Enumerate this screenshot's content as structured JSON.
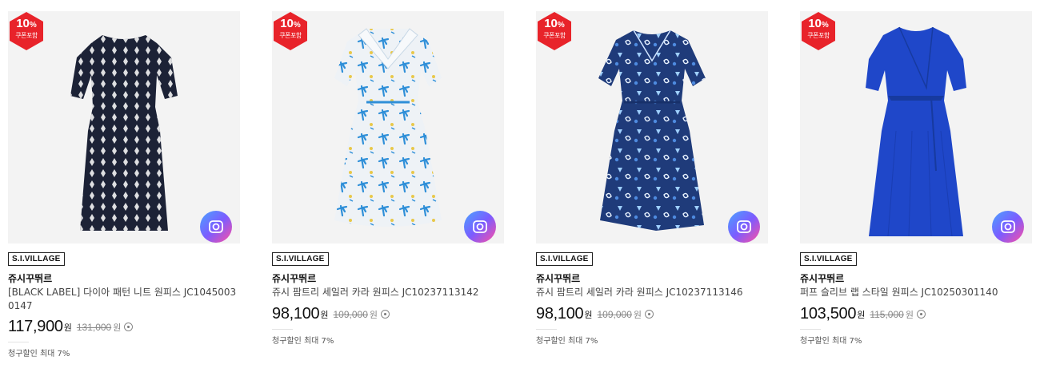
{
  "products": [
    {
      "badge_percent": "10",
      "badge_unit": "%",
      "badge_sub": "쿠폰포함",
      "mall_tag": "S.I.VILLAGE",
      "brand": "쥬시꾸뛰르",
      "name": "[BLACK LABEL] 다이아 패턴 니트 원피스 JC1045003 0147",
      "price": "117,900",
      "price_unit": "원",
      "original_price": "131,000",
      "original_unit": "원",
      "discount_note": "청구할인 최대 7%",
      "dress_color": "#1c2236",
      "pattern_color": "#f4f4f4"
    },
    {
      "badge_percent": "10",
      "badge_unit": "%",
      "badge_sub": "쿠폰포함",
      "mall_tag": "S.I.VILLAGE",
      "brand": "쥬시꾸뛰르",
      "name": "쥬시 팜트리 세일러 카라 원피스 JC10237113142",
      "price": "98,100",
      "price_unit": "원",
      "original_price": "109,000",
      "original_unit": "원",
      "discount_note": "청구할인 최대 7%",
      "dress_color": "#eef2f6",
      "pattern_color": "#2f8fd8"
    },
    {
      "badge_percent": "10",
      "badge_unit": "%",
      "badge_sub": "쿠폰포함",
      "mall_tag": "S.I.VILLAGE",
      "brand": "쥬시꾸뛰르",
      "name": "쥬시 팜트리 세일러 카라 원피스 JC10237113146",
      "price": "98,100",
      "price_unit": "원",
      "original_price": "109,000",
      "original_unit": "원",
      "discount_note": "청구할인 최대 7%",
      "dress_color": "#1f3b7a",
      "pattern_color": "#9fd0ff"
    },
    {
      "badge_percent": "10",
      "badge_unit": "%",
      "badge_sub": "쿠폰포함",
      "mall_tag": "S.I.VILLAGE",
      "brand": "쥬시꾸뛰르",
      "name": "퍼프 슬리브 랩 스타일 원피스 JC10250301140",
      "price": "103,500",
      "price_unit": "원",
      "original_price": "115,000",
      "original_unit": "원",
      "discount_note": "청구할인 최대 7%",
      "dress_color": "#1f47c9",
      "pattern_color": "#1f47c9"
    }
  ],
  "colors": {
    "badge_red": "#e8232a",
    "thumb_bg": "#f3f3f3",
    "camera_gradient": [
      "#4aa3ff",
      "#7b5cff",
      "#ff4fa3"
    ]
  },
  "icons": {
    "badge": "hexagon-badge",
    "camera": "camera-icon",
    "info": "info-circle-icon"
  }
}
